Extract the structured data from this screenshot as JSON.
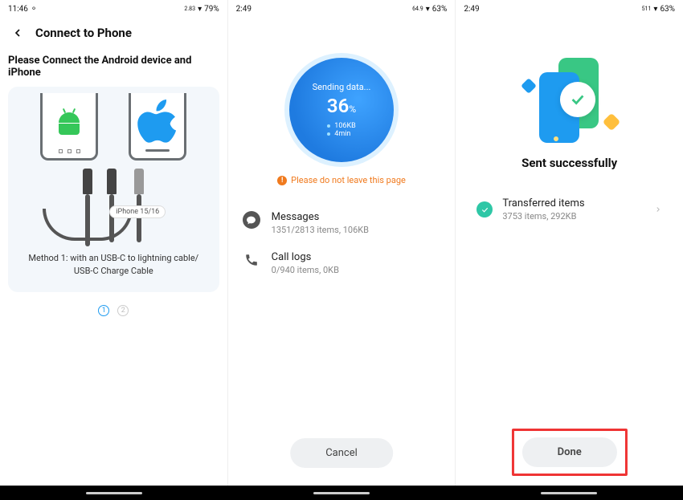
{
  "panel1": {
    "status": {
      "time": "11:46",
      "battery": "79%",
      "net": "2.83"
    },
    "title": "Connect to Phone",
    "subtitle": "Please Connect the Android device and iPhone",
    "cable_label": "iPhone 15/16",
    "method_line1": "Method 1: with an USB-C to lightning cable/",
    "method_line2": "USB-C Charge Cable",
    "pager": {
      "p1": "1",
      "p2": "2"
    }
  },
  "panel2": {
    "status": {
      "time": "2:49",
      "battery": "63%",
      "net": "64.9"
    },
    "sending_label": "Sending data...",
    "percent": "36",
    "percent_unit": "%",
    "stat_size": "106KB",
    "stat_time": "4min",
    "warning": "Please do not leave this page",
    "items": {
      "messages": {
        "title": "Messages",
        "sub": "1351/2813 items, 106KB"
      },
      "calllogs": {
        "title": "Call logs",
        "sub": "0/940 items, 0KB"
      }
    },
    "cancel": "Cancel"
  },
  "panel3": {
    "status": {
      "time": "2:49",
      "battery": "63%",
      "net": "511"
    },
    "title": "Sent successfully",
    "row": {
      "title": "Transferred items",
      "sub": "3753 items, 292KB"
    },
    "done": "Done"
  }
}
